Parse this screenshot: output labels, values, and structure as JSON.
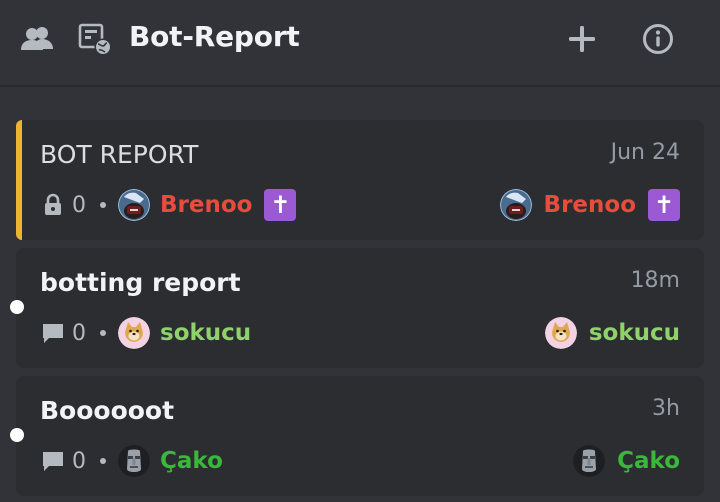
{
  "header": {
    "title": "Bot-Report",
    "icons": [
      "members-icon",
      "forum-channel-icon",
      "plus-icon",
      "info-icon"
    ]
  },
  "colors": {
    "pinned_accent": "#f0b232",
    "brenoo": "#e74c3c",
    "sokucu": "#8fd16a",
    "cako": "#3ab83a",
    "badge": "#9b59d6"
  },
  "threads": [
    {
      "title": "BOT REPORT",
      "time": "Jun 24",
      "count": "0",
      "status_icon": "lock-icon",
      "author": "Brenoo",
      "author_badge": "✝",
      "last_user": "Brenoo",
      "last_badge": "✝"
    },
    {
      "title": "botting report",
      "time": "18m",
      "count": "0",
      "status_icon": "message-icon",
      "author": "sokucu",
      "last_user": "sokucu"
    },
    {
      "title": "Boooooot",
      "time": "3h",
      "count": "0",
      "status_icon": "message-icon",
      "author": "Çako",
      "last_user": "Çako"
    }
  ]
}
